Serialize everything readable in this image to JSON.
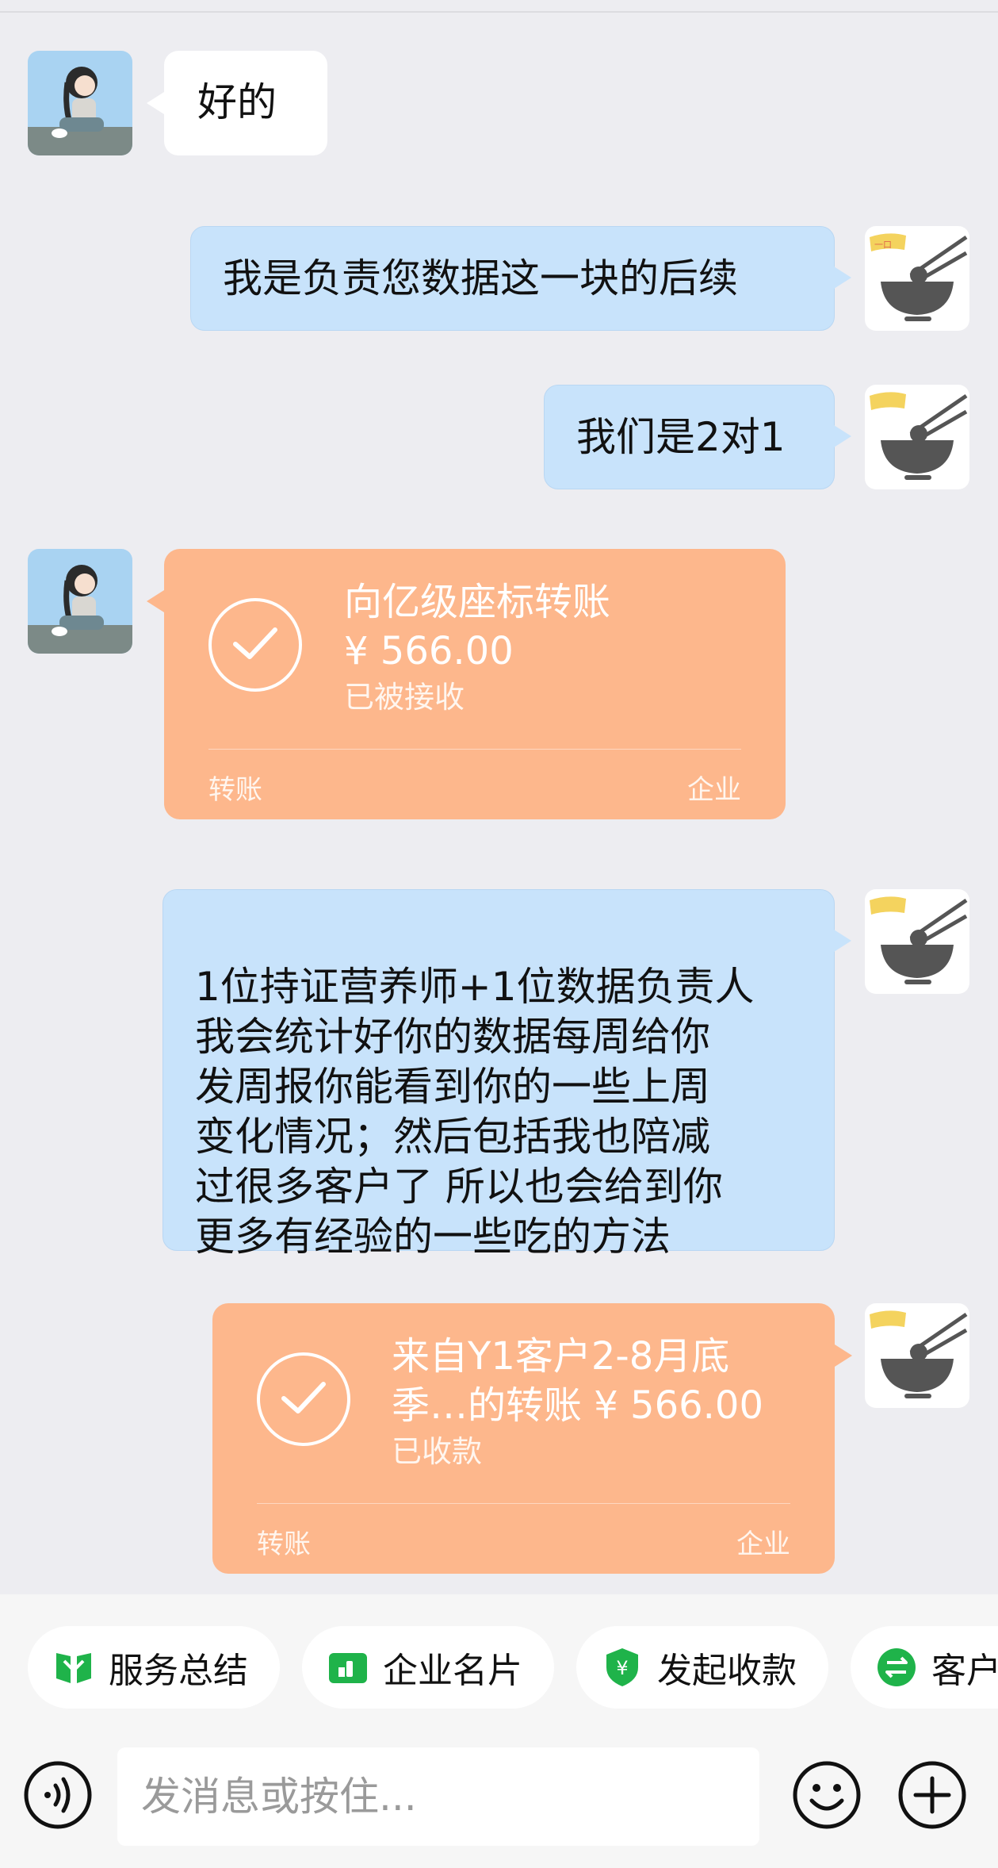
{
  "messages": {
    "m1": {
      "text": "好的"
    },
    "m2": {
      "text": "我是负责您数据这一块的后续"
    },
    "m3": {
      "text": "我们是2对1"
    },
    "m4": {
      "title": "向亿级座标转账",
      "amount": "¥ 566.00",
      "status": "已被接收",
      "foot_left": "转账",
      "foot_right": "企业"
    },
    "m5": {
      "text": "1位持证营养师+1位数据负责人\n我会统计好你的数据每周给你\n发周报你能看到你的一些上周\n变化情况；然后包括我也陪减\n过很多客户了 所以也会给到你\n更多有经验的一些吃的方法"
    },
    "m6": {
      "title_line1": "来自Y1客户2-8月底",
      "title_line2": "季…的转账 ¥ 566.00",
      "status": "已收款",
      "foot_left": "转账",
      "foot_right": "企业"
    }
  },
  "quick_actions": [
    {
      "label": "服务总结",
      "icon": "bookmark-icon",
      "color": "#1fb34a"
    },
    {
      "label": "企业名片",
      "icon": "business-card-icon",
      "color": "#1fb34a"
    },
    {
      "label": "发起收款",
      "icon": "yuan-shield-icon",
      "color": "#1fb34a"
    },
    {
      "label": "客户",
      "icon": "exchange-icon",
      "color": "#1fb34a"
    }
  ],
  "composer": {
    "placeholder": "发消息或按住..."
  },
  "colors": {
    "background": "#ededf1",
    "blue_bubble": "#c8e3fb",
    "transfer_card": "#fdb78c",
    "accent_green": "#1fb34a"
  }
}
